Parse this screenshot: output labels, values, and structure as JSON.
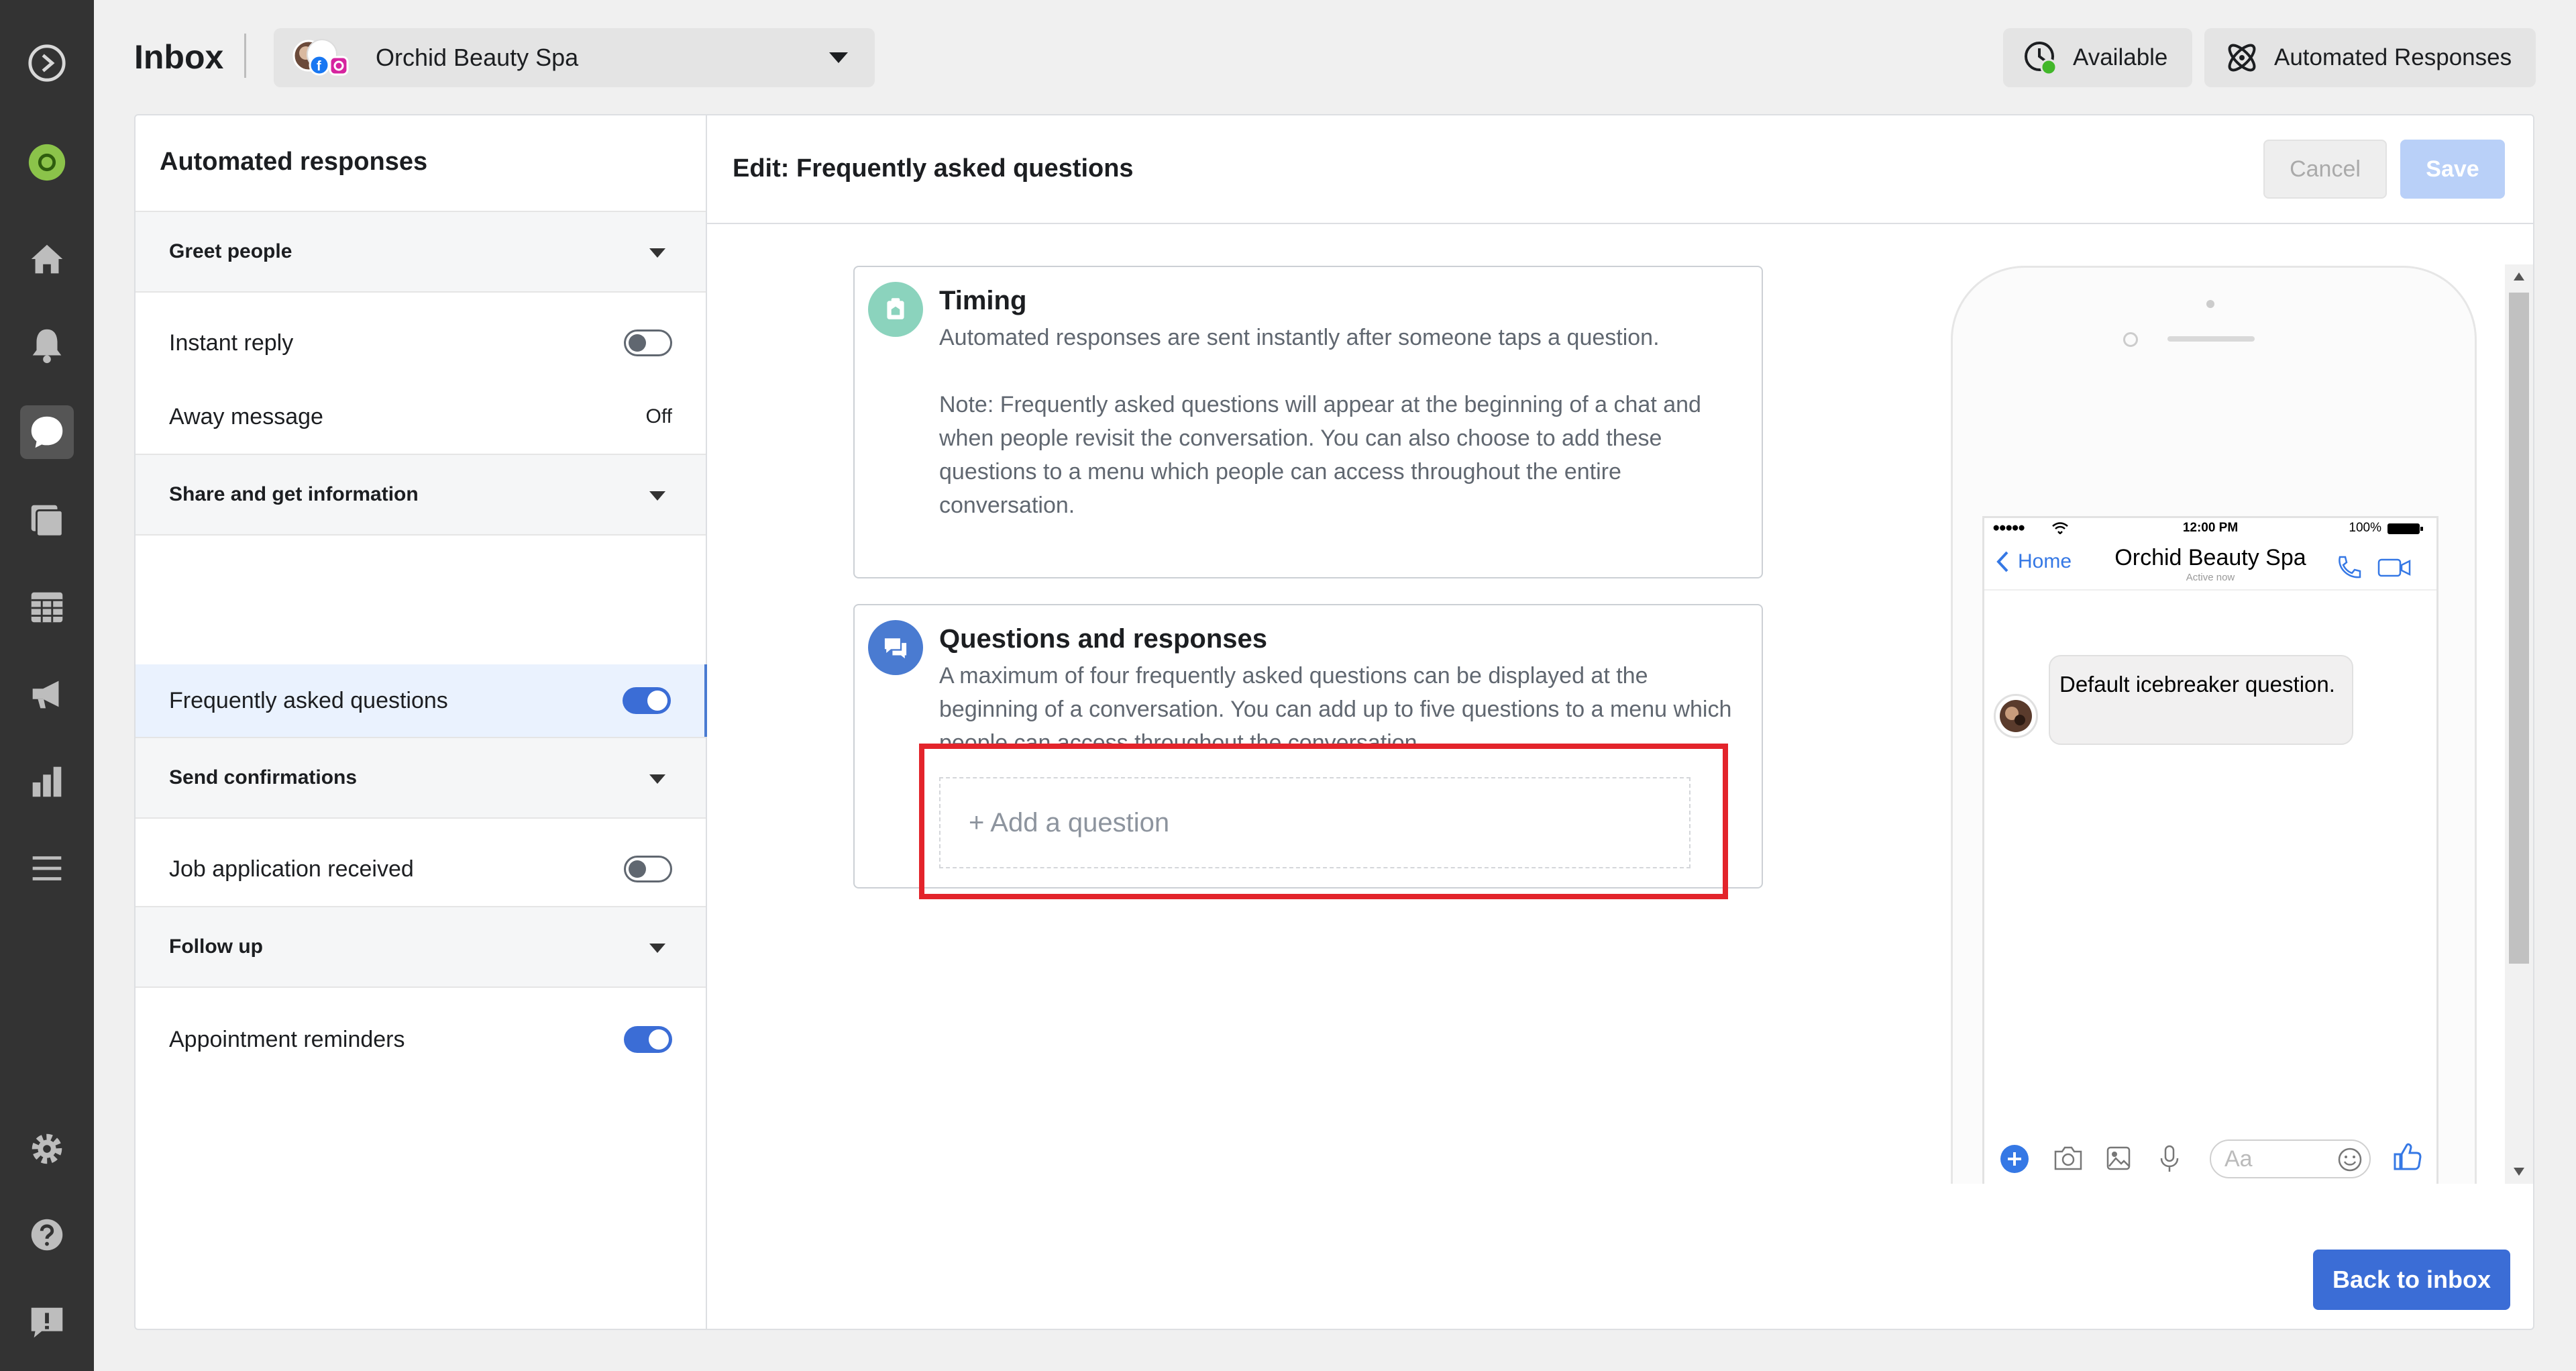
{
  "header": {
    "title": "Inbox",
    "page_selector": {
      "label": "Orchid Beauty Spa"
    },
    "available_label": "Available",
    "automated_label": "Automated Responses"
  },
  "left_panel": {
    "title": "Automated responses",
    "sections": [
      {
        "label": "Greet people",
        "items": [
          {
            "label": "Instant reply",
            "control": "toggle",
            "state": "off"
          },
          {
            "label": "Away message",
            "control": "status",
            "status": "Off"
          }
        ]
      },
      {
        "label": "Share and get information",
        "items": [
          {
            "label": "Frequently asked questions",
            "control": "toggle",
            "state": "on",
            "selected": true
          }
        ]
      },
      {
        "label": "Send confirmations",
        "items": [
          {
            "label": "Job application received",
            "control": "toggle",
            "state": "off"
          }
        ]
      },
      {
        "label": "Follow up",
        "items": [
          {
            "label": "Appointment reminders",
            "control": "toggle",
            "state": "on"
          }
        ]
      }
    ]
  },
  "editor": {
    "title": "Edit: Frequently asked questions",
    "cancel_label": "Cancel",
    "save_label": "Save",
    "timing": {
      "title": "Timing",
      "line1": "Automated responses are sent instantly after someone taps a question.",
      "note": "Note: Frequently asked questions will appear at the beginning of a chat and when people revisit the conversation. You can also choose to add these questions to a menu which people can access throughout the entire conversation."
    },
    "questions": {
      "title": "Questions and responses",
      "body": "A maximum of four frequently asked questions can be displayed at the beginning of a conversation. You can add up to five questions to a menu which people can access throughout the conversation.",
      "add_label": "+ Add a question"
    },
    "back_label": "Back to inbox"
  },
  "phone_preview": {
    "time": "12:00 PM",
    "battery": "100%",
    "signal": "●●●●●",
    "home_label": "Home",
    "page_name": "Orchid Beauty Spa",
    "active_status": "Active now",
    "message": "Default icebreaker question.",
    "composer_placeholder": "Aa"
  },
  "colors": {
    "rail_bg": "#333333",
    "accent_blue": "#3b6dd6",
    "toggle_on": "#3b6dd6",
    "highlight_red": "#e3242b",
    "available_dot": "#42b72a",
    "timing_icon": "#8bd3bd",
    "questions_icon": "#4a7bd1"
  }
}
